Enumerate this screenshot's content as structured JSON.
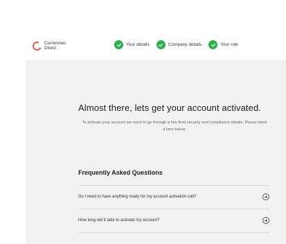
{
  "brand": {
    "line1": "Currencies",
    "line2": "Direct",
    "logo_color": "#e85a3c"
  },
  "steps": [
    {
      "label": "Your details",
      "status": "complete",
      "icon": "check-circle-icon"
    },
    {
      "label": "Company details",
      "status": "complete",
      "icon": "check-circle-icon"
    },
    {
      "label": "Your role",
      "status": "complete",
      "icon": "check-circle-icon"
    }
  ],
  "colors": {
    "step_complete": "#2db14a",
    "panel_background": "#f2f2f2"
  },
  "main": {
    "title": "Almost there, lets get your account activated.",
    "subtitle": "To activate your account we need to go through a few final security and compliance details. Please book a time below."
  },
  "faq": {
    "heading": "Frequently Asked Questions",
    "items": [
      {
        "question": "Do I need to have anything ready for my account activation call?",
        "icon": "plus-circle-icon"
      },
      {
        "question": "How long will it take to activate my account?",
        "icon": "plus-circle-icon"
      }
    ]
  }
}
